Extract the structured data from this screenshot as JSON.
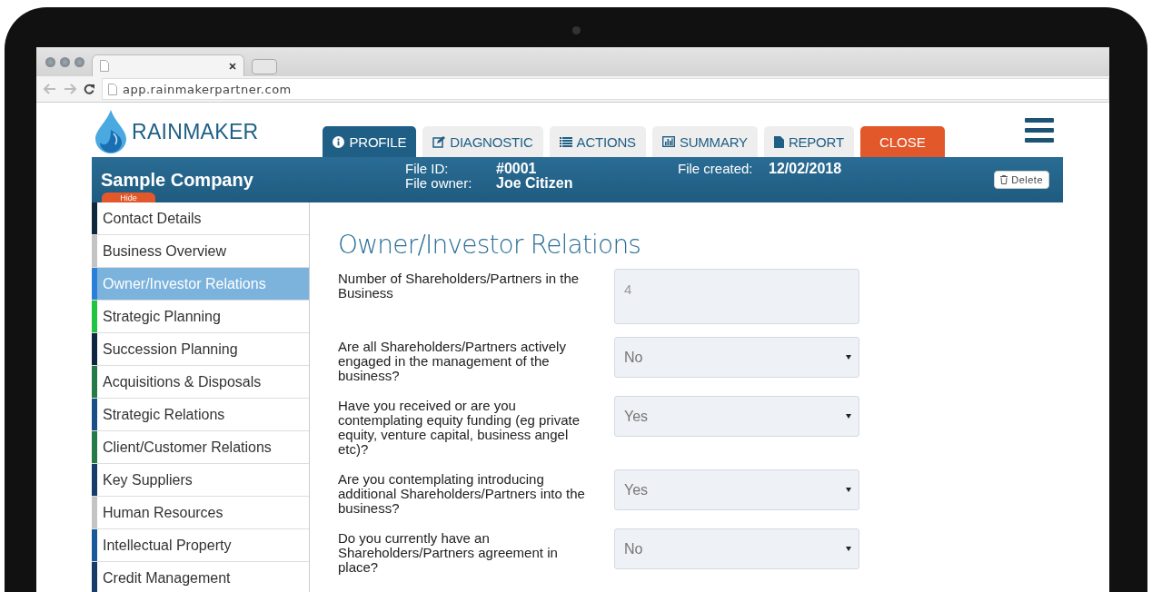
{
  "browser": {
    "url": "app.rainmakerpartner.com"
  },
  "app": {
    "logo_text": "RAINMAKER"
  },
  "tabs": [
    {
      "label": "PROFILE",
      "selected": true
    },
    {
      "label": "DIAGNOSTIC",
      "selected": false
    },
    {
      "label": "ACTIONS",
      "selected": false
    },
    {
      "label": "SUMMARY",
      "selected": false
    },
    {
      "label": "REPORT",
      "selected": false
    }
  ],
  "close_button": "CLOSE",
  "file_bar": {
    "company": "Sample Company",
    "hide_label": "Hide",
    "file_id_label": "File ID:",
    "file_id": "#0001",
    "owner_label": "File owner:",
    "owner": "Joe Citizen",
    "created_label": "File created:",
    "created": "12/02/2018",
    "delete_label": "Delete"
  },
  "sidebar": {
    "items": [
      {
        "label": "Contact Details",
        "color": "#10283c",
        "selected": false
      },
      {
        "label": "Business Overview",
        "color": "#c4c4c4",
        "selected": false
      },
      {
        "label": "Owner/Investor Relations",
        "color": "#2b7fd6",
        "selected": true
      },
      {
        "label": "Strategic Planning",
        "color": "#1fc43f",
        "selected": false
      },
      {
        "label": "Succession Planning",
        "color": "#0f2640",
        "selected": false
      },
      {
        "label": "Acquisitions & Disposals",
        "color": "#257a48",
        "selected": false
      },
      {
        "label": "Strategic Relations",
        "color": "#1a4e86",
        "selected": false
      },
      {
        "label": "Client/Customer Relations",
        "color": "#257a48",
        "selected": false
      },
      {
        "label": "Key Suppliers",
        "color": "#173c6a",
        "selected": false
      },
      {
        "label": "Human Resources",
        "color": "#c4c4c4",
        "selected": false
      },
      {
        "label": "Intellectual Property",
        "color": "#1a5a9a",
        "selected": false
      },
      {
        "label": "Credit Management",
        "color": "#173c6a",
        "selected": false
      }
    ]
  },
  "form": {
    "title": "Owner/Investor Relations",
    "fields": [
      {
        "kind": "text",
        "label": "Number of Shareholders/Partners in the Business",
        "value": "4"
      },
      {
        "kind": "select",
        "label": "Are all Shareholders/Partners actively engaged in the management of the business?",
        "value": "No"
      },
      {
        "kind": "select",
        "label": "Have you received or are you contemplating equity funding (eg private equity, venture capital, business angel etc)?",
        "value": "Yes"
      },
      {
        "kind": "select",
        "label": "Are you contemplating introducing additional Shareholders/Partners into the business?",
        "value": "Yes"
      },
      {
        "kind": "select",
        "label": "Do you currently have an Shareholders/Partners agreement in place?",
        "value": "No"
      }
    ]
  }
}
